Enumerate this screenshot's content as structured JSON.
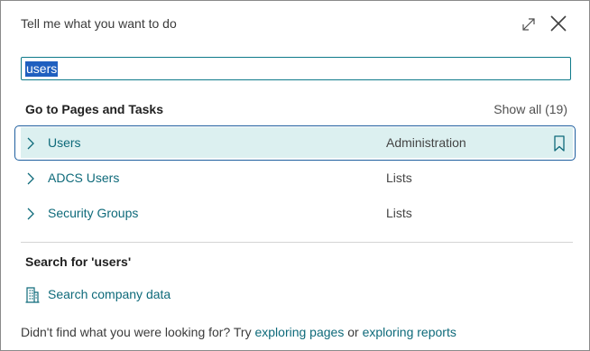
{
  "dialog": {
    "title": "Tell me what you want to do",
    "icons": {
      "expand": "expand-icon",
      "close": "close-icon"
    }
  },
  "search": {
    "value": "users"
  },
  "pages_section": {
    "title": "Go to Pages and Tasks",
    "show_all": "Show all (19)",
    "items": [
      {
        "label": "Users",
        "category": "Administration",
        "selected": true
      },
      {
        "label": "ADCS Users",
        "category": "Lists",
        "selected": false
      },
      {
        "label": "Security Groups",
        "category": "Lists",
        "selected": false
      }
    ]
  },
  "search_section": {
    "title": "Search for 'users'",
    "company_data": "Search company data"
  },
  "footer": {
    "prefix": "Didn't find what you were looking for? Try ",
    "link_pages": "exploring pages",
    "middle": " or ",
    "link_reports": "exploring reports"
  },
  "colors": {
    "accent": "#0e6a7a",
    "selection_bg": "#dcf0f0",
    "focus_border": "#1f5f9f",
    "text_highlight": "#1f5fbf"
  }
}
